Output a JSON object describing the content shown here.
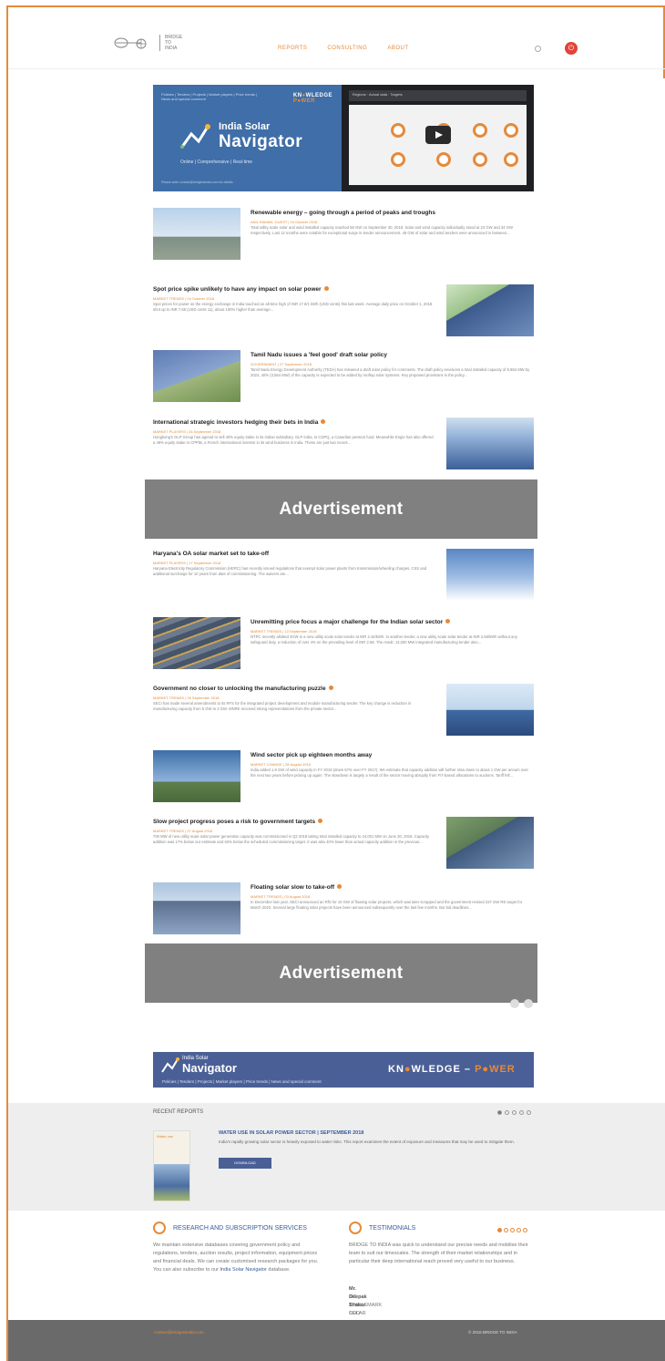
{
  "header": {
    "logo_text": [
      "BRIDGE",
      "TO",
      "INDIA"
    ],
    "nav": [
      "REPORTS",
      "CONSULTING",
      "ABOUT"
    ]
  },
  "hero": {
    "crumb": "Policies | Tenders | Projects | Market players | Price trends | News and special comment",
    "kp_a": "KN",
    "kp_b": "WLEDGE",
    "kp_c": "P",
    "kp_d": "WER",
    "subtitle": "India Solar",
    "title": "Navigator",
    "tagline": "Online | Comprehensive | Real-time",
    "foot": "Please write contact@bridgetoindia.com for details",
    "screen_title": "Regions · Actual data · Targets"
  },
  "articles": [
    {
      "title": "Renewable energy – going through a period of peaks and troughs",
      "meta": "ANIL RAMAN, GUEST | 04 October 2018",
      "body": "Total utility scale solar and wind installed capacity reached 58 GW on September 30, 2018. Solar and wind capacity individually stood at 24 GW and 34 GW respectively. Last 12 months were notable for exceptional surge in tender announcement. 46 GW of solar and wind tenders were announced in between..."
    },
    {
      "title": "Spot price spike unlikely to have any impact on solar power",
      "meta": "MARKET TRENDS | 04 October 2018",
      "body": "Spot prices for power on the energy exchange in India touched an all-time high of INR 17.6/1 kWh (USD cents) this last week. Average daily price on October 1, 2018 shot up to INR 7.66 (USD cents 11), about 100% higher than average..."
    },
    {
      "title": "Tamil Nadu issues a 'feel good' draft solar policy",
      "meta": "GOVERNMENT | 27 September 2018",
      "body": "Tamil Nadu Energy Development Authority (TEDA) has released a draft solar policy for comments. The draft policy envisions a total installed capacity of 8,884 MW by 2023, 40% (3,554 MW) of the capacity is expected to be added by rooftop solar systems. Key proposed provisions in the policy..."
    },
    {
      "title": "International strategic investors hedging their bets in India",
      "meta": "MARKET PLAYERS | 26 September 2018",
      "body": "Hongkong's GLP Group has agreed to sell 40% equity stake in its Indian subsidiary, GLP India, to CDPQ, a Canadian pension fund. Meanwhile Engie has also offered a 49% equity stake to CPPIB, a French international investor in its wind business in India. These are just two recent..."
    },
    {
      "title": "Haryana's OA solar market set to take-off",
      "meta": "MARKET PLAYERS | 17 September 2018",
      "body": "Haryana Electricity Regulatory Commission (HERC) has recently issued regulations that exempt solar power plants from transmission/wheeling charges, CSS and additional surcharge for 10 years from date of commissioning. The waivers are..."
    },
    {
      "title": "Unremitting price focus a major challenge for the Indian solar sector",
      "meta": "MARKET TRENDS | 13 September 2018",
      "body": "NTPC recently allotted 3GW in a new utility scale solar tender at INR 2.44/kWh. In another tender, a new utility scale solar tender at INR 2.55/kWh without any safeguard duty, a reduction of over 4% on the prevailing level of INR 2.58. The result: 13,000 MW integrated manufacturing tender also..."
    },
    {
      "title": "Government no closer to unlocking the manufacturing puzzle",
      "meta": "MARKET TRENDS | 05 September 2018",
      "body": "SECI has made several amendments to its RFS for the integrated project development and module manufacturing tender. The key change is reduction in manufacturing capacity from 5 GW to 3 GW. MNRE received strong representations from the private sector..."
    },
    {
      "title": "Wind sector pick up eighteen months away",
      "meta": "MARKET CHANGE | 28 August 2018",
      "body": "India added 1.6 GW of wind capacity in FY 2018 (down 67% over FY 2017). We estimate that capacity addition will further slow down to about 1 GW per annum over the next two years before picking up again. The slowdown is largely a result of the sector moving abruptly from FiT-based allocations to auctions. Tariff fell..."
    },
    {
      "title": "Slow project progress poses a risk to government targets",
      "meta": "MARKET TRENDS | 07 August 2018",
      "body": "700 MW of new utility scale solar power generation capacity was commissioned in Q2 2018 taking total installed capacity to 24,001 MW on June 30, 2018. Capacity addition was 17% below our estimate and 63% below the scheduled commissioning target. It was also 40% lower than actual capacity addition in the previous..."
    },
    {
      "title": "Floating solar slow to take-off",
      "meta": "MARKET TRENDS | 03 August 2018",
      "body": "In December last year, SECI announced an RfS for 10 GW of floating solar projects, which was later scrapped and the government revised 227 GW RE target for March 2022. Several large floating solar projects have been announced subsequently over the last few months. But bid deadlines..."
    }
  ],
  "ads": [
    "Advertisement",
    "Advertisement"
  ],
  "banner2": {
    "subtitle": "India Solar",
    "title": "Navigator",
    "links": "Policies | Tenders | Projects | Market players | Price trends | News and special comment",
    "kp_a": "KN",
    "kp_b": "WLEDGE",
    "kp_c": "P",
    "kp_d": "WER",
    "kp_sep": "–"
  },
  "reports": {
    "heading": "RECENT REPORTS",
    "title": "WATER USE IN SOLAR POWER SECTOR | SEPTEMBER 2018",
    "body": "India's rapidly growing solar sector is heavily exposed to water risks. This report examines the extent of exposure and measures that may be used to mitigate them.",
    "download": "DOWNLOAD",
    "thumb_label": "Water use"
  },
  "research": {
    "title": "RESEARCH AND SUBSCRIPTION SERVICES",
    "body": "We maintain extensive databases covering government policy and regulations, tenders, auction results, project information, equipment prices and financial deals. We can create customised research packages for you. You can also subscribe to our",
    "link": "India Solar Navigator",
    "tail": "database."
  },
  "testimonials": {
    "title": "TESTIMONIALS",
    "quote": "BRIDGE TO INDIA was quick to understand our precise needs and mobilise their team to suit our timescales. The strength of their market relationships and in particular their deep international reach proved very useful to our business.",
    "name": "Mr. Deepak Thakur",
    "role": "MD & CEO",
    "company": "SINGLEMARK SOLAR"
  },
  "footer": {
    "left": "contact@bridgetoindia.com",
    "right": "© 2018 BRIDGE TO INDIA"
  },
  "colors": {
    "accent": "#e58a3a",
    "navy": "#4a5f96",
    "hero": "#3f6ea8",
    "ad": "#808080"
  }
}
